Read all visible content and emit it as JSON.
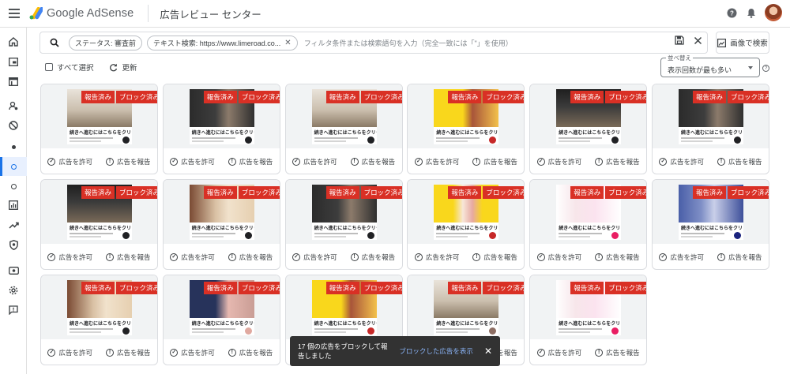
{
  "header": {
    "brand": "Google AdSense",
    "page_title": "広告レビュー センター"
  },
  "filter": {
    "chips": [
      {
        "label": "ステータス: 審査前",
        "removable": false
      },
      {
        "label": "テキスト検索: https://www.limeroad.co...",
        "removable": true
      }
    ],
    "placeholder": "フィルタ条件または検索語句を入力（完全一致には「\"」を使用）",
    "image_search_label": "画像で検索"
  },
  "toolbar": {
    "select_all": "すべて選択",
    "refresh": "更新"
  },
  "sort": {
    "label": "並べ替え",
    "value": "表示回数が最も多い"
  },
  "card_labels": {
    "reported": "報告済み",
    "blocked": "ブロック済み",
    "allow": "広告を許可",
    "report": "広告を報告",
    "cta": "続きへ進むにはこちらをクリック"
  },
  "ads": [
    {
      "theme": "room",
      "go": "#202124"
    },
    {
      "theme": "dark-fashion",
      "go": "#202124"
    },
    {
      "theme": "room",
      "go": "#202124"
    },
    {
      "theme": "yellow-40off",
      "go": "#c62828"
    },
    {
      "theme": "dark-room",
      "go": "#202124"
    },
    {
      "theme": "dark-fashion",
      "go": "#202124"
    },
    {
      "theme": "dark-room",
      "go": "#202124"
    },
    {
      "theme": "beige-60off",
      "go": "#202124"
    },
    {
      "theme": "dark-fashion",
      "go": "#202124"
    },
    {
      "theme": "yellow-woman",
      "go": "#c62828"
    },
    {
      "theme": "white-pink",
      "go": "#e91e63"
    },
    {
      "theme": "blue-woman",
      "go": "#1a237e"
    },
    {
      "theme": "beige-60off",
      "go": "#202124"
    },
    {
      "theme": "navy-50off",
      "go": "#e0a9a0"
    },
    {
      "theme": "yellow-40off",
      "go": "#c62828"
    },
    {
      "theme": "room",
      "go": "#8d6e63"
    },
    {
      "theme": "white-pink",
      "go": "#e91e63"
    }
  ],
  "snackbar": {
    "message": "17 個の広告をブロックして報告しました",
    "action": "ブロックした広告を表示"
  }
}
